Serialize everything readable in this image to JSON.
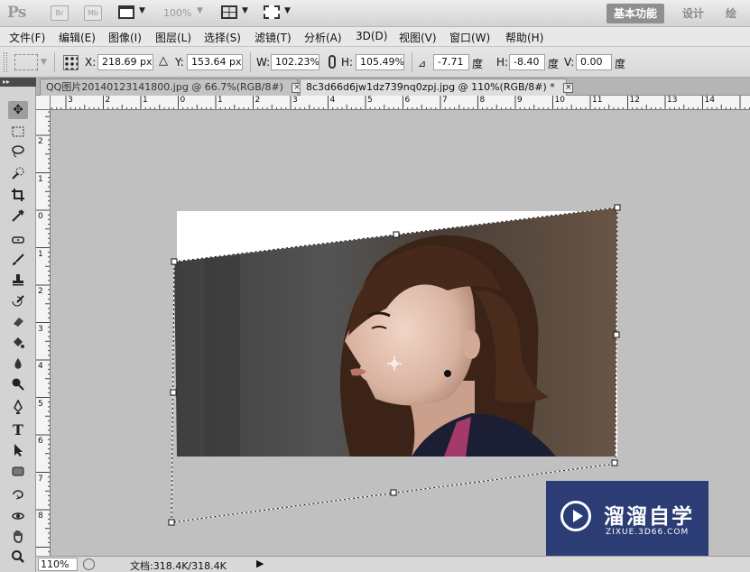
{
  "app": {
    "logo": "Ps",
    "bridge_label": "Br",
    "minibridge_label": "Mb",
    "zoom_level": "100%",
    "workspaces": [
      "基本功能",
      "设计",
      "绘画"
    ]
  },
  "menu": [
    "文件(F)",
    "编辑(E)",
    "图像(I)",
    "图层(L)",
    "选择(S)",
    "滤镜(T)",
    "分析(A)",
    "3D(D)",
    "视图(V)",
    "窗口(W)",
    "帮助(H)"
  ],
  "options": {
    "x_label": "X:",
    "x_value": "218.69 px",
    "y_label": "Y:",
    "y_value": "153.64 px",
    "w_label": "W:",
    "w_value": "102.23%",
    "h_label": "H:",
    "h_value": "105.49%",
    "angle_value": "-7.71",
    "angle_unit": "度",
    "hskew_label": "H:",
    "hskew_value": "-8.40",
    "hskew_unit": "度",
    "vskew_label": "V:",
    "vskew_value": "0.00",
    "vskew_unit": "度"
  },
  "tabs": [
    {
      "label": "QQ图片20140123141800.jpg @ 66.7%(RGB/8#)",
      "close": "×",
      "active": false
    },
    {
      "label": "8c3d66d6jw1dz739nq0zpj.jpg @ 110%(RGB/8#) *",
      "close": "×",
      "active": true
    }
  ],
  "ruler_top": [
    "3",
    "2",
    "1",
    "0",
    "1",
    "2",
    "3",
    "4",
    "5",
    "6",
    "7",
    "8",
    "9",
    "10",
    "11",
    "12",
    "13",
    "14"
  ],
  "ruler_left": [
    "2",
    "1",
    "0",
    "1",
    "2",
    "3",
    "4",
    "5",
    "6",
    "7",
    "8"
  ],
  "status": {
    "zoom": "110%",
    "doc_info": "文档:318.4K/318.4K",
    "arrow": "▶"
  },
  "watermark": {
    "title": "溜溜自学",
    "subtitle": "ZIXUE.3D66.COM"
  },
  "colors": {
    "canvas_bg": "#c0c0c0",
    "workspace_active": "#8f8f8f",
    "watermark_bg": "#1e326e"
  }
}
